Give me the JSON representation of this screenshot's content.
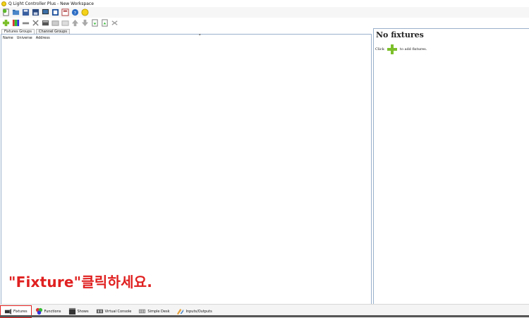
{
  "window": {
    "title": "Q Light Controller Plus - New Workspace"
  },
  "toolbar_main": [
    "new-workspace-icon",
    "open-icon",
    "save-icon",
    "save-as-icon",
    "monitor-icon",
    "fullscreen-icon",
    "address-tool-icon",
    "help-icon",
    "about-icon"
  ],
  "toolbar_fixtures": [
    "add-fixture-icon",
    "add-rgb-panel-icon",
    "remove-fixture-icon",
    "configure-icon",
    "properties-icon",
    "group-icon",
    "ungroup-icon",
    "move-up-icon",
    "move-down-icon",
    "import-icon",
    "export-icon",
    "remap-icon"
  ],
  "upper_tabs": {
    "fixtures_groups": "Fixtures Groups",
    "channel_groups": "Channel Groups"
  },
  "columns": {
    "name": "Name",
    "universe": "Universe",
    "address": "Address"
  },
  "info": {
    "heading": "No fixtures",
    "click": "Click",
    "add_fixtures": "to add fixtures."
  },
  "instruction": "\"Fixture\"클릭하세요.",
  "bottom_tabs": {
    "fixtures": "Fixtures",
    "functions": "Functions",
    "shows": "Shows",
    "virtual_console": "Virtual Console",
    "simple_desk": "Simple Desk",
    "inputs_outputs": "Inputs/Outputs"
  },
  "colors": {
    "accent_red": "#e02020",
    "panel_border": "#9ab0cc",
    "plus_green": "#7cbf2b"
  }
}
